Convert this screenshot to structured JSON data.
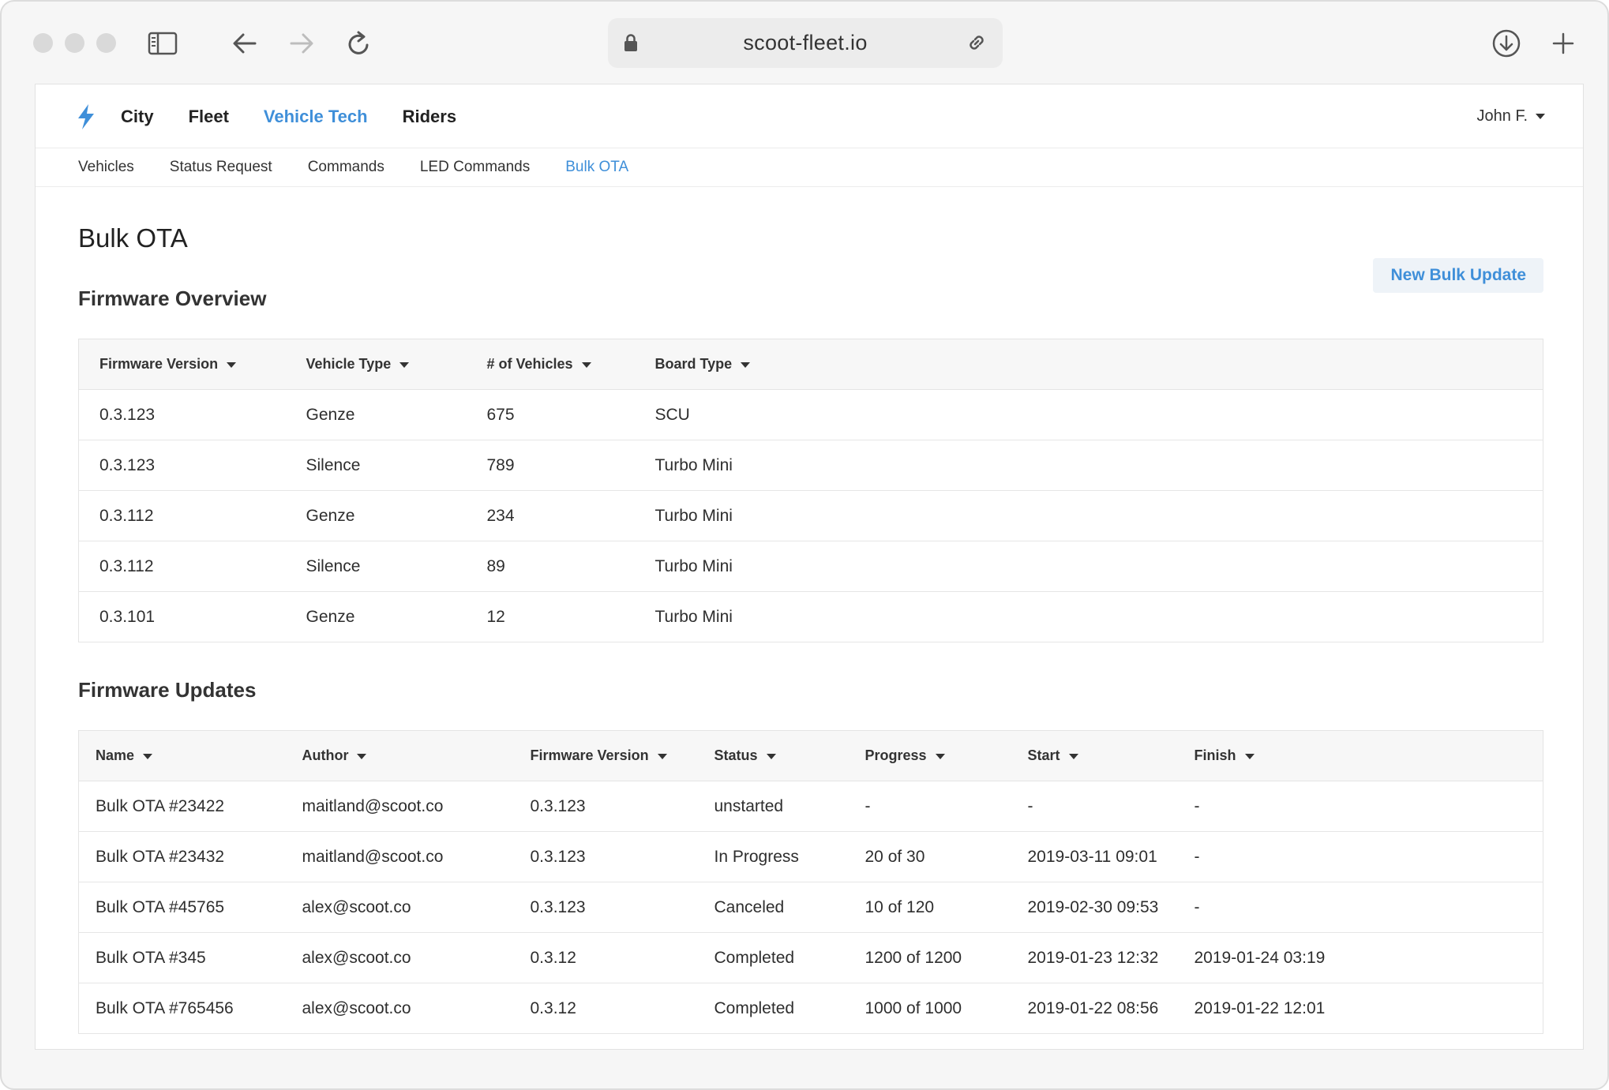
{
  "browser": {
    "url": "scoot-fleet.io"
  },
  "topnav": {
    "items": [
      {
        "label": "City",
        "active": false
      },
      {
        "label": "Fleet",
        "active": false
      },
      {
        "label": "Vehicle Tech",
        "active": true
      },
      {
        "label": "Riders",
        "active": false
      }
    ],
    "user_label": "John F."
  },
  "subnav": {
    "items": [
      {
        "label": "Vehicles",
        "active": false
      },
      {
        "label": "Status Request",
        "active": false
      },
      {
        "label": "Commands",
        "active": false
      },
      {
        "label": "LED Commands",
        "active": false
      },
      {
        "label": "Bulk OTA",
        "active": true
      }
    ]
  },
  "page": {
    "title": "Bulk OTA",
    "new_button_label": "New Bulk Update"
  },
  "firmware_overview": {
    "title": "Firmware Overview",
    "columns": [
      "Firmware Version",
      "Vehicle Type",
      "# of Vehicles",
      "Board Type"
    ],
    "rows": [
      [
        "0.3.123",
        "Genze",
        "675",
        "SCU"
      ],
      [
        "0.3.123",
        "Silence",
        "789",
        "Turbo Mini"
      ],
      [
        "0.3.112",
        "Genze",
        "234",
        "Turbo Mini"
      ],
      [
        "0.3.112",
        "Silence",
        "89",
        "Turbo Mini"
      ],
      [
        "0.3.101",
        "Genze",
        "12",
        "Turbo Mini"
      ]
    ]
  },
  "firmware_updates": {
    "title": "Firmware Updates",
    "columns": [
      "Name",
      "Author",
      "Firmware Version",
      "Status",
      "Progress",
      "Start",
      "Finish"
    ],
    "rows": [
      {
        "name": "Bulk OTA #23422",
        "author": "maitland@scoot.co",
        "version": "0.3.123",
        "status": "unstarted",
        "status_tone": "normal",
        "progress": "-",
        "start": "-",
        "finish": "-"
      },
      {
        "name": "Bulk OTA #23432",
        "author": "maitland@scoot.co",
        "version": "0.3.123",
        "status": "In Progress",
        "status_tone": "green",
        "progress": "20 of 30",
        "start": "2019-03-11 09:01",
        "finish": "-"
      },
      {
        "name": "Bulk OTA #45765",
        "author": "alex@scoot.co",
        "version": "0.3.123",
        "status": "Canceled",
        "status_tone": "red",
        "progress": "10 of 120",
        "start": "2019-02-30 09:53",
        "finish": "-"
      },
      {
        "name": "Bulk OTA #345",
        "author": "alex@scoot.co",
        "version": "0.3.12",
        "status": "Completed",
        "status_tone": "normal",
        "progress": "1200 of 1200",
        "start": "2019-01-23 12:32",
        "finish": "2019-01-24 03:19"
      },
      {
        "name": "Bulk OTA #765456",
        "author": "alex@scoot.co",
        "version": "0.3.12",
        "status": "Completed",
        "status_tone": "normal",
        "progress": "1000 of 1000",
        "start": "2019-01-22 08:56",
        "finish": "2019-01-22 12:01"
      }
    ]
  },
  "colors": {
    "accent": "#3f8fd9",
    "status_green": "#1e9e3c",
    "status_red": "#cc1b1b"
  },
  "icons": {
    "sidebar_toggle": "sidebar-icon",
    "back": "arrow-left-icon",
    "forward": "arrow-right-icon",
    "reload": "reload-icon",
    "lock": "lock-icon",
    "share_link": "link-icon",
    "download": "download-icon",
    "new_tab": "plus-icon",
    "brand": "lightning-bolt-icon"
  }
}
